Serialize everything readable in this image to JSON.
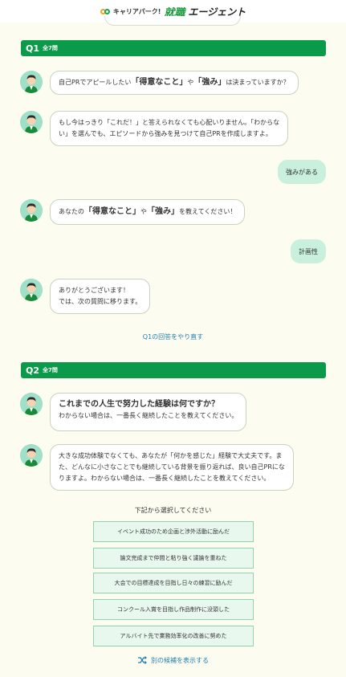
{
  "header": {
    "brand_small": "キャリアパーク!",
    "brand_main1": "就職",
    "brand_main2": "エージェント"
  },
  "q1": {
    "label": "Q1",
    "total": "全7問",
    "msg1_pre": "自己PRでアピールしたい",
    "msg1_b1": "「得意なこと」",
    "msg1_mid": "や",
    "msg1_b2": "「強み」",
    "msg1_post": "は決まっていますか？",
    "msg2_line1": "もし今はっきり「これだ！」と答えられなくても心配いりません。「わからな",
    "msg2_line2": "い」を選んでも、エピソードから強みを見つけて自己PRを作成しますよ。",
    "reply1": "強みがある",
    "msg3_pre": "あなたの",
    "msg3_b1": "「得意なこと」",
    "msg3_mid": "や",
    "msg3_b2": "「強み」",
    "msg3_post": "を教えてください！",
    "reply2": "計画性",
    "msg4_line1": "ありがとうございます！",
    "msg4_line2": "では、次の質問に移ります。",
    "redo_link": "Q1の回答をやり直す"
  },
  "q2": {
    "label": "Q2",
    "total": "全7問",
    "msg1_title": "これまでの人生で努力した経験は何ですか？",
    "msg1_sub": "わからない場合は、一番長く継続したことを教えてください。",
    "msg2_line1": "大きな成功体験でなくても、あなたが「何かを感じた」経験で大丈夫です。ま",
    "msg2_line2": "た、どんなに小さなことでも継続している背景を振り返れば、良い自己PRにな",
    "msg2_line3": "りますよ。わからない場合は、一番長く継続したことを教えてください。",
    "prompt": "下記から選択してください",
    "choices": [
      "イベント成功のため企画と渉外活動に励んだ",
      "論文完成まで仲間と粘り強く議論を重ねた",
      "大会での目標達成を目指し日々の練習に励んだ",
      "コンクール入賞を目指し作品制作に没頭した",
      "アルバイト先で業務効率化の改善に努めた"
    ],
    "more_link": "別の候補を表示する"
  },
  "colors": {
    "accent_green": "#0b9a4a",
    "reply_bg": "#c8f0dd",
    "choice_bg": "#e8f8ee",
    "link": "#1e7fb0"
  }
}
